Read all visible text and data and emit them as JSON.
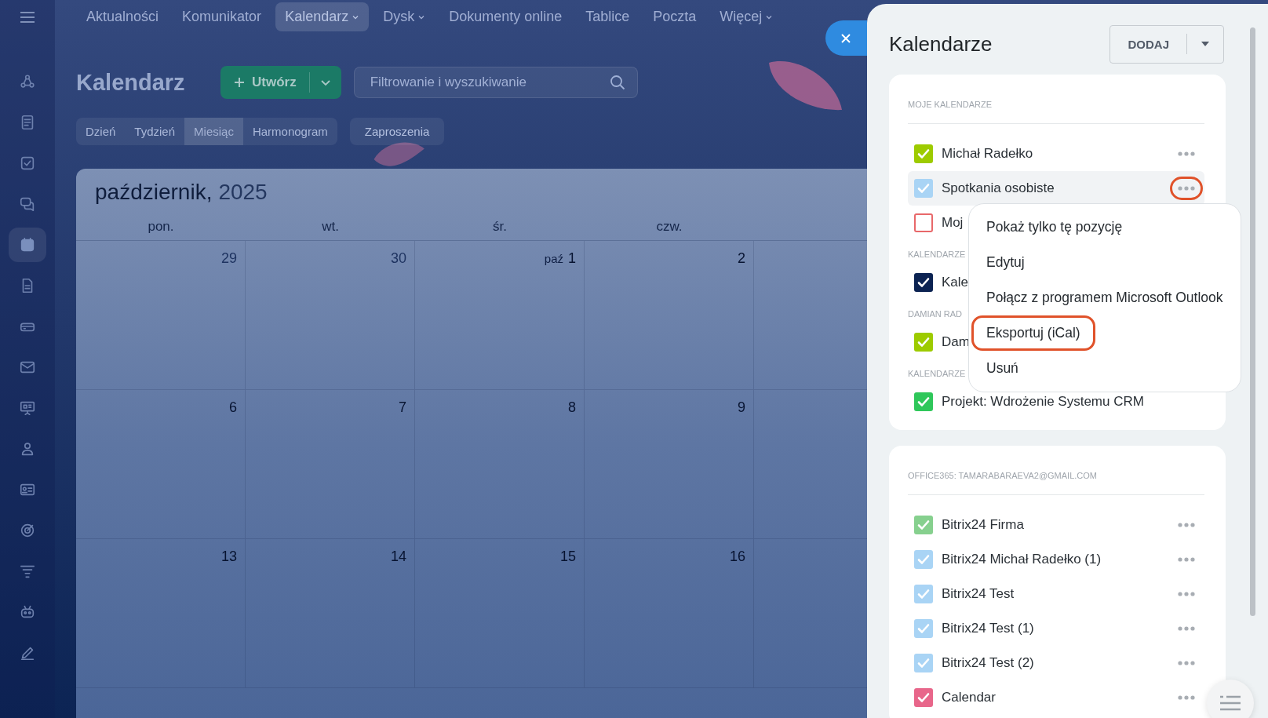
{
  "sidebar": {
    "items": [
      {
        "kind": "hub",
        "selected": false
      },
      {
        "kind": "feed",
        "selected": false
      },
      {
        "kind": "tasks",
        "selected": false
      },
      {
        "kind": "chat",
        "selected": false
      },
      {
        "kind": "calendar",
        "selected": true
      },
      {
        "kind": "document",
        "selected": false
      },
      {
        "kind": "drive",
        "selected": false
      },
      {
        "kind": "mail",
        "selected": false
      },
      {
        "kind": "board",
        "selected": false
      },
      {
        "kind": "people",
        "selected": false
      },
      {
        "kind": "contact",
        "selected": false
      },
      {
        "kind": "target",
        "selected": false
      },
      {
        "kind": "filter",
        "selected": false
      },
      {
        "kind": "robot",
        "selected": false
      },
      {
        "kind": "pencil",
        "selected": false
      }
    ]
  },
  "top_nav": {
    "items": [
      {
        "label": "Aktualności",
        "selected": false,
        "dropdown": false
      },
      {
        "label": "Komunikator",
        "selected": false,
        "dropdown": false
      },
      {
        "label": "Kalendarz",
        "selected": true,
        "dropdown": true
      },
      {
        "label": "Dysk",
        "selected": false,
        "dropdown": true
      },
      {
        "label": "Dokumenty online",
        "selected": false,
        "dropdown": false
      },
      {
        "label": "Tablice",
        "selected": false,
        "dropdown": false
      },
      {
        "label": "Poczta",
        "selected": false,
        "dropdown": false
      },
      {
        "label": "Więcej",
        "selected": false,
        "dropdown": true
      }
    ]
  },
  "page_title": "Kalendarz",
  "create_button": {
    "label": "Utwórz"
  },
  "search": {
    "placeholder": "Filtrowanie i wyszukiwanie"
  },
  "view_tabs": [
    {
      "label": "Dzień",
      "selected": false
    },
    {
      "label": "Tydzień",
      "selected": false
    },
    {
      "label": "Miesiąc",
      "selected": true
    },
    {
      "label": "Harmonogram",
      "selected": false
    }
  ],
  "invitations_button": {
    "label": "Zaproszenia"
  },
  "calendar": {
    "month": "październik,",
    "year": "2025",
    "weekdays": [
      "pon.",
      "wt.",
      "śr.",
      "czw."
    ],
    "weeks": [
      [
        {
          "day": "29",
          "other_month": true
        },
        {
          "day": "30",
          "other_month": true
        },
        {
          "day": "1",
          "month_label": "paź",
          "other_month": false
        },
        {
          "day": "2",
          "other_month": false
        }
      ],
      [
        {
          "day": "6",
          "other_month": false
        },
        {
          "day": "7",
          "other_month": false
        },
        {
          "day": "8",
          "other_month": false
        },
        {
          "day": "9",
          "other_month": false
        }
      ],
      [
        {
          "day": "13",
          "other_month": false
        },
        {
          "day": "14",
          "other_month": false
        },
        {
          "day": "15",
          "other_month": false
        },
        {
          "day": "16",
          "other_month": false
        }
      ]
    ]
  },
  "panel": {
    "title": "Kalendarze",
    "add_button": {
      "label": "DODAJ"
    },
    "cards": [
      {
        "sections": [
          {
            "title": "MOJE KALENDARZE",
            "items": [
              {
                "name": "Michał Radełko",
                "color": "#9dcb00",
                "checked": true,
                "active": false,
                "more": true,
                "annotated": false
              },
              {
                "name": "Spotkania osobiste",
                "color": "#a9d4f5",
                "checked": true,
                "active": true,
                "more": true,
                "annotated": true
              },
              {
                "name": "Moj",
                "color": "#e8686a",
                "checked": false,
                "active": false,
                "more": false
              }
            ]
          },
          {
            "title": "KALENDARZE",
            "items": [
              {
                "name": "Kale",
                "color": "#0c2352",
                "checked": true,
                "active": false,
                "more": false
              }
            ]
          },
          {
            "title": "DAMIAN RAD",
            "items": [
              {
                "name": "Dam",
                "color": "#9dcb00",
                "checked": true,
                "active": false,
                "more": false
              }
            ]
          },
          {
            "title": "KALENDARZE",
            "items": [
              {
                "name": "Projekt: Wdrożenie Systemu CRM",
                "color": "#2fc75a",
                "checked": true,
                "active": false,
                "more": false
              }
            ]
          }
        ]
      },
      {
        "sections": [
          {
            "title": "OFFICE365: TAMARABARAEVA2@GMAIL.COM",
            "items": [
              {
                "name": "Bitrix24 Firma",
                "color": "#86d08e",
                "checked": true,
                "active": false,
                "more": true,
                "annotated": false
              },
              {
                "name": "Bitrix24 Michał Radełko (1)",
                "color": "#a9d4f5",
                "checked": true,
                "active": false,
                "more": true,
                "annotated": false
              },
              {
                "name": "Bitrix24 Test",
                "color": "#a9d4f5",
                "checked": true,
                "active": false,
                "more": true,
                "annotated": false
              },
              {
                "name": "Bitrix24 Test (1)",
                "color": "#a9d4f5",
                "checked": true,
                "active": false,
                "more": true,
                "annotated": false
              },
              {
                "name": "Bitrix24 Test (2)",
                "color": "#a9d4f5",
                "checked": true,
                "active": false,
                "more": true,
                "annotated": false
              },
              {
                "name": "Calendar",
                "color": "#e8668a",
                "checked": true,
                "active": false,
                "more": true,
                "annotated": false
              }
            ]
          }
        ]
      }
    ]
  },
  "context_menu": {
    "items": [
      {
        "label": "Pokaż tylko tę pozycję",
        "annotated": false
      },
      {
        "label": "Edytuj",
        "annotated": false
      },
      {
        "label": "Połącz z programem Microsoft Outlook",
        "annotated": false
      },
      {
        "label": "Eksportuj (iCal)",
        "annotated": true
      },
      {
        "label": "Usuń",
        "annotated": false
      }
    ]
  }
}
